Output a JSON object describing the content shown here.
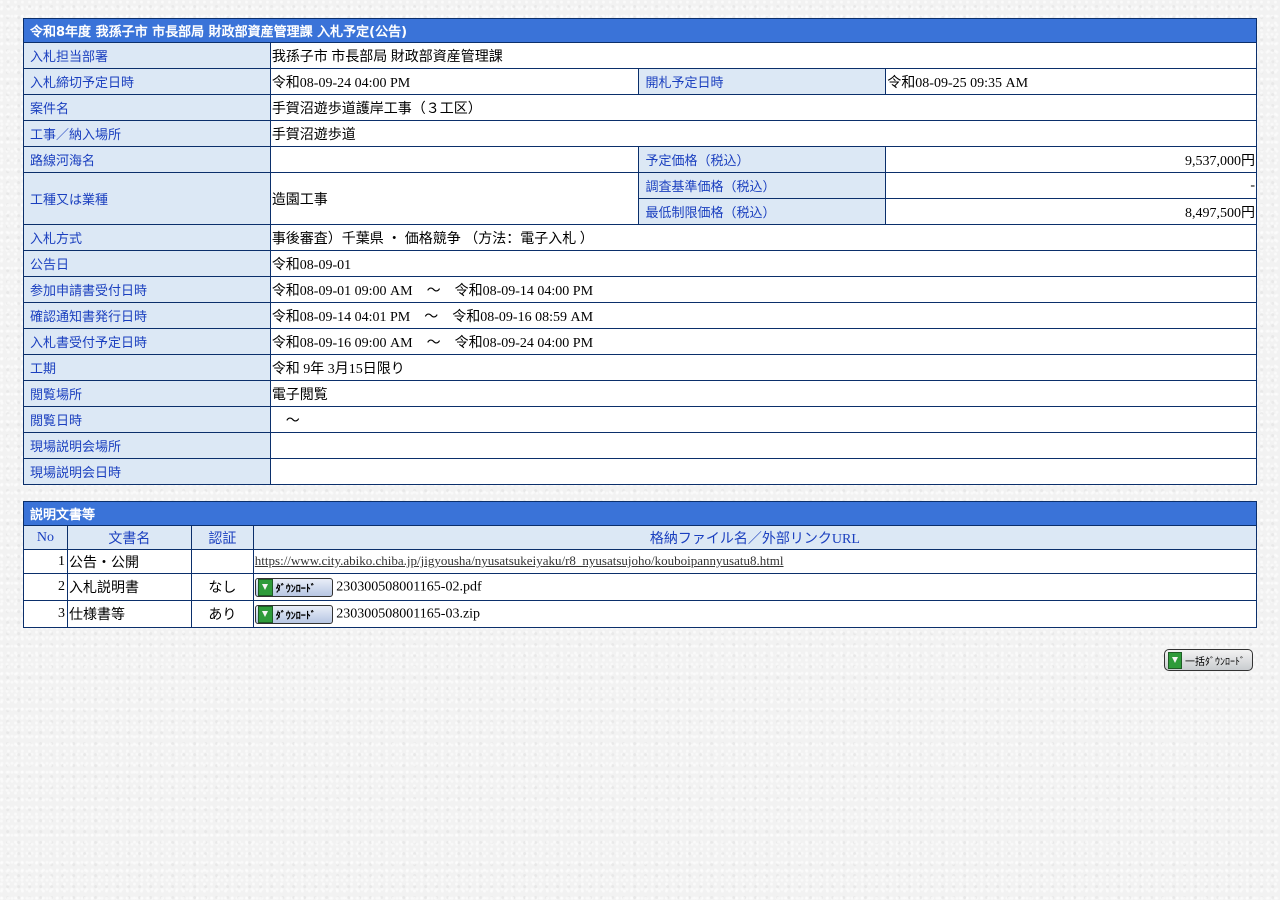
{
  "notice": {
    "title": "令和8年度  我孫子市  市長部局  財政部資産管理課  入札予定(公告)",
    "department_label": "入札担当部署",
    "department_value": "我孫子市  市長部局  財政部資産管理課",
    "deadline_label": "入札締切予定日時",
    "deadline_value": "令和08-09-24 04:00 PM",
    "opening_label": "開札予定日時",
    "opening_value": "令和08-09-25 09:35 AM",
    "case_label": "案件名",
    "case_value": "手賀沼遊歩道護岸工事（３工区）",
    "location_label": "工事／納入場所",
    "location_value": "手賀沼遊歩道",
    "route_label": "路線河海名",
    "route_value": "",
    "planned_price_label": "予定価格（税込）",
    "planned_price_value": "9,537,000円",
    "type_label": "工種又は業種",
    "type_value": "造園工事",
    "survey_price_label": "調査基準価格（税込）",
    "survey_price_value": "-",
    "min_price_label": "最低制限価格（税込）",
    "min_price_value": "8,497,500円",
    "method_label": "入札方式",
    "method_value": "事後審査）千葉県 ・ 価格競争 （方法：電子入札 ）",
    "announce_label": "公告日",
    "announce_value": "令和08-09-01",
    "application_label": "参加申請書受付日時",
    "application_value": "令和08-09-01 09:00 AM　～　令和08-09-14 04:00 PM",
    "confirm_label": "確認通知書発行日時",
    "confirm_value": "令和08-09-14 04:01 PM　～　令和08-09-16 08:59 AM",
    "bid_accept_label": "入札書受付予定日時",
    "bid_accept_value": "令和08-09-16 09:00 AM　～　令和08-09-24 04:00 PM",
    "period_label": "工期",
    "period_value": "令和 9年 3月15日限り",
    "view_place_label": "閲覧場所",
    "view_place_value": "電子閲覧",
    "view_date_label": "閲覧日時",
    "view_date_value": "　～",
    "briefing_place_label": "現場説明会場所",
    "briefing_place_value": "",
    "briefing_date_label": "現場説明会日時",
    "briefing_date_value": ""
  },
  "documents": {
    "title": "説明文書等",
    "col_no": "No",
    "col_name": "文書名",
    "col_auth": "認証",
    "col_file": "格納ファイル名／外部リンクURL",
    "download_label": "ﾀﾞｳﾝﾛｰﾄﾞ",
    "rows": [
      {
        "no": "1",
        "name": "公告・公開",
        "auth": "",
        "url": "https://www.city.abiko.chiba.jp/jigyousha/nyusatsukeiyaku/r8_nyusatsujoho/kouboipannyusatu8.html"
      },
      {
        "no": "2",
        "name": "入札説明書",
        "auth": "なし",
        "file": "230300508001165-02.pdf"
      },
      {
        "no": "3",
        "name": "仕様書等",
        "auth": "あり",
        "file": "230300508001165-03.zip"
      }
    ]
  },
  "bulk_download_label": "一括ﾀﾞｳﾝﾛｰﾄﾞ"
}
